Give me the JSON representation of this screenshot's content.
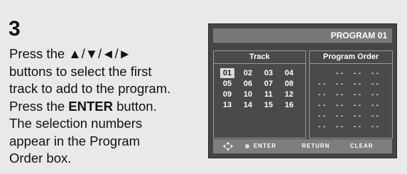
{
  "step": {
    "number": "3"
  },
  "instructions": {
    "line1": "Press the ▲/▼/◄/► ",
    "line2": "buttons to select the first",
    "line3": "track to add to the program.",
    "line4_prefix": "Press the ",
    "line4_bold": "ENTER",
    "line4_suffix": " button.",
    "line5": "The selection numbers",
    "line6": "appear in the Program",
    "line7": "Order box."
  },
  "screen": {
    "title": "PROGRAM 01",
    "track_header": "Track",
    "program_header": "Program  Order",
    "tracks": [
      "01",
      "02",
      "03",
      "04",
      "05",
      "06",
      "07",
      "08",
      "09",
      "10",
      "11",
      "12",
      "13",
      "14",
      "15",
      "16"
    ],
    "selected_track": "01",
    "program_slot": "- -",
    "buttons": {
      "enter": "ENTER",
      "return": "RETURN",
      "clear": "CLEAR"
    }
  },
  "colors": {
    "panel_bg": "#e9e9e9",
    "screen_bg": "#454545",
    "selected_bg": "#dcdcdc"
  }
}
